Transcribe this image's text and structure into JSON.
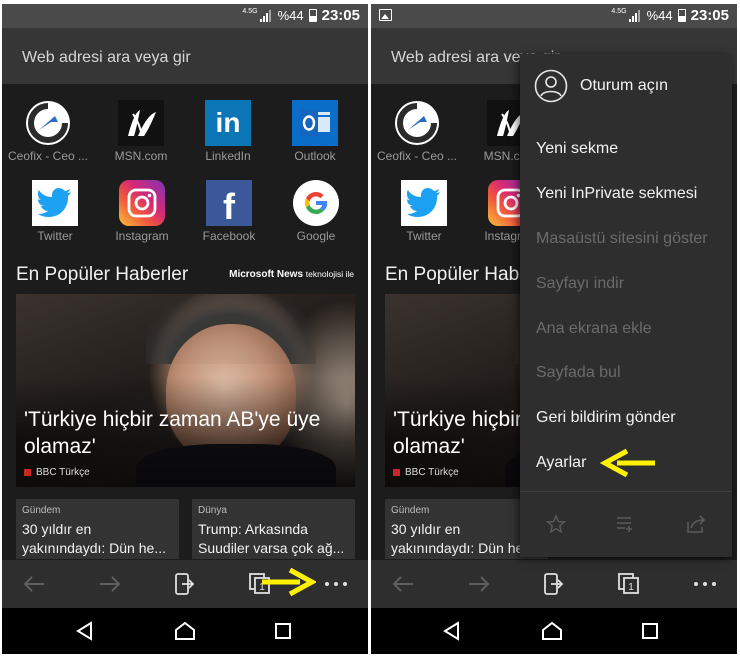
{
  "status_bar": {
    "network": "4.5G",
    "battery": "%44",
    "time": "23:05"
  },
  "address_bar": {
    "placeholder": "Web adresi ara veya gir"
  },
  "tiles": [
    {
      "label": "Ceofix - Ceo ...",
      "icon": "ceofix-logo-icon"
    },
    {
      "label": "MSN.com",
      "icon": "msn-logo-icon"
    },
    {
      "label": "LinkedIn",
      "icon": "linkedin-logo-icon"
    },
    {
      "label": "Outlook",
      "icon": "outlook-logo-icon"
    },
    {
      "label": "Twitter",
      "icon": "twitter-logo-icon"
    },
    {
      "label": "Instagram",
      "icon": "instagram-logo-icon"
    },
    {
      "label": "Facebook",
      "icon": "facebook-logo-icon"
    },
    {
      "label": "Google",
      "icon": "google-logo-icon"
    }
  ],
  "news": {
    "title": "En Popüler Haberler",
    "credit_brand": "Microsoft News",
    "credit_suffix": "teknolojisi ile",
    "hero": {
      "headline": "'Türkiye hiçbir zaman AB'ye üye olamaz'",
      "source": "BBC Türkçe"
    },
    "cards": [
      {
        "category": "Gündem",
        "text": "30 yıldır en\nyakınındaydı: Dün he..."
      },
      {
        "category": "Dünya",
        "text": "Trump: Arkasında\nSuudiler varsa çok ağ..."
      }
    ]
  },
  "menu": {
    "sign_in": "Oturum açın",
    "items": [
      {
        "label": "Yeni sekme",
        "enabled": true
      },
      {
        "label": "Yeni InPrivate sekmesi",
        "enabled": true
      },
      {
        "label": "Masaüstü sitesini göster",
        "enabled": false
      },
      {
        "label": "Sayfayı indir",
        "enabled": false
      },
      {
        "label": "Ana ekrana ekle",
        "enabled": false
      },
      {
        "label": "Sayfada bul",
        "enabled": false
      },
      {
        "label": "Geri bildirim gönder",
        "enabled": true
      },
      {
        "label": "Ayarlar",
        "enabled": true
      }
    ],
    "bottom_icons": [
      "star-icon",
      "reading-list-icon",
      "share-icon"
    ]
  },
  "toolbar_icons": [
    "back-arrow-icon",
    "forward-arrow-icon",
    "send-to-pc-icon",
    "tabs-icon",
    "more-icon"
  ],
  "tabs_count": "1",
  "colors": {
    "annotation_arrow": "#fff200",
    "accent_ms": "#0078d7",
    "dark_bg": "#1c1c1c"
  }
}
